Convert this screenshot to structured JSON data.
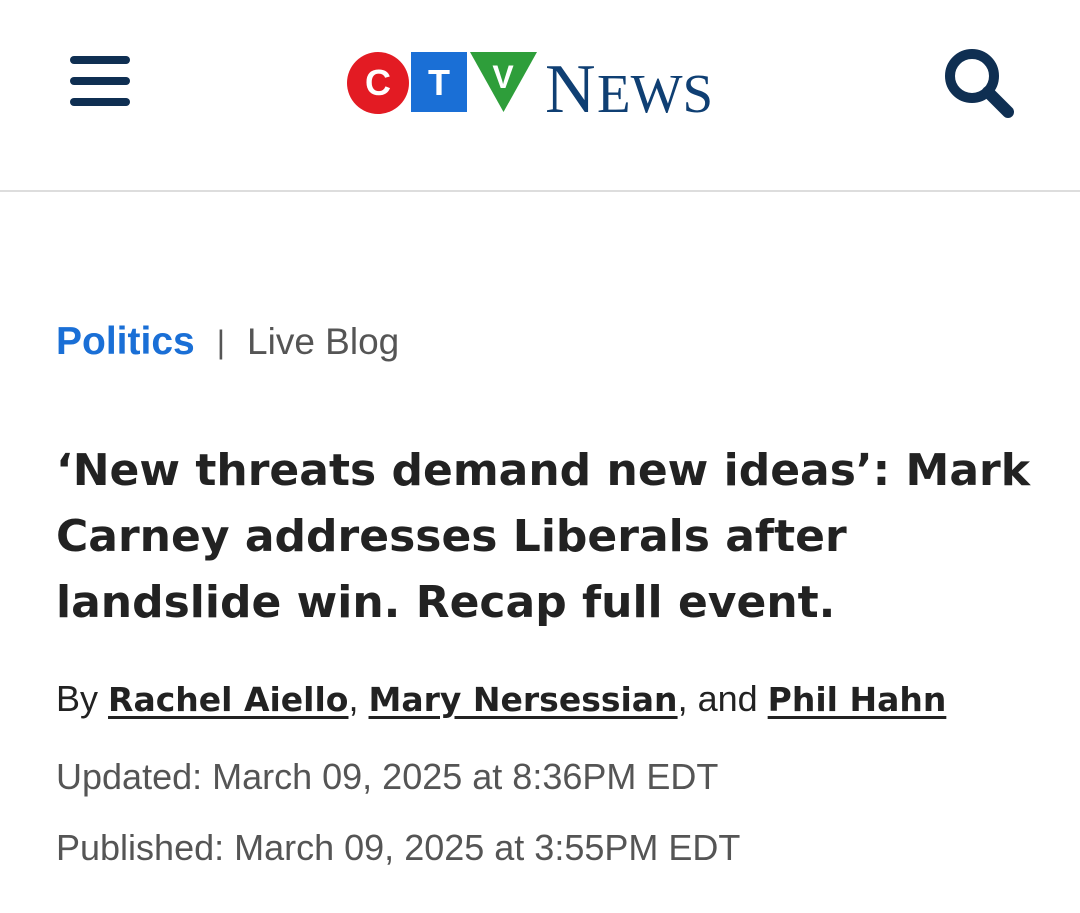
{
  "header": {
    "menu_icon": "hamburger-menu-icon",
    "logo": {
      "letters": [
        "C",
        "T",
        "V"
      ],
      "wordmark_initial": "N",
      "wordmark_rest": "EWS",
      "colors": {
        "c": "#e31b23",
        "t": "#1a6fd6",
        "v": "#2e9e3a",
        "news": "#0f3f73"
      }
    },
    "search_icon": "search-icon"
  },
  "article": {
    "section": "Politics",
    "separator": "|",
    "format_tag": "Live Blog",
    "headline": "‘New threats demand new ideas’: Mark Carney addresses Liberals after landslide win. Recap full event.",
    "byline": {
      "prefix": "By",
      "authors": [
        "Rachel Aiello",
        "Mary Nersessian",
        "Phil Hahn"
      ],
      "sep1": ",",
      "sep2": ", and"
    },
    "updated": "Updated: March 09, 2025 at 8:36PM EDT",
    "published": "Published: March 09, 2025 at 3:55PM EDT"
  },
  "colors": {
    "accent_link": "#1a6fd6",
    "navy": "#0f2f52",
    "text": "#222222",
    "muted": "#555555"
  }
}
